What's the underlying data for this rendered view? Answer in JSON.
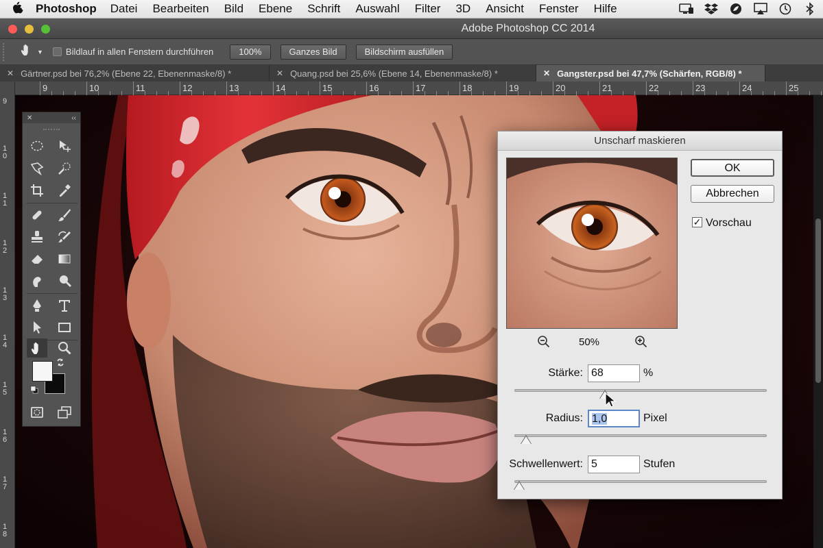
{
  "menubar": {
    "app_name": "Photoshop",
    "items": [
      "Datei",
      "Bearbeiten",
      "Bild",
      "Ebene",
      "Schrift",
      "Auswahl",
      "Filter",
      "3D",
      "Ansicht",
      "Fenster",
      "Hilfe"
    ]
  },
  "window": {
    "title": "Adobe Photoshop CC 2014"
  },
  "options_bar": {
    "scroll_all_label": "Bildlauf in allen Fenstern durchführen",
    "btn_100": "100%",
    "btn_fit": "Ganzes Bild",
    "btn_fill": "Bildschirm ausfüllen"
  },
  "tabs": [
    {
      "label": "Gärtner.psd bei 76,2% (Ebene 22, Ebenenmaske/8) *",
      "active": false
    },
    {
      "label": "Quang.psd bei 25,6% (Ebene 14, Ebenenmaske/8) *",
      "active": false
    },
    {
      "label": "Gangster.psd bei 47,7% (Schärfen, RGB/8) *",
      "active": true
    }
  ],
  "ruler": {
    "h_labels": [
      "9",
      "10",
      "11",
      "12",
      "13",
      "14",
      "15",
      "16",
      "17",
      "18",
      "19",
      "20",
      "21",
      "22",
      "23",
      "24",
      "25"
    ],
    "v_labels": [
      "9",
      "10",
      "11",
      "12",
      "13",
      "14",
      "15",
      "16",
      "17",
      "18"
    ]
  },
  "dialog": {
    "title": "Unscharf maskieren",
    "ok": "OK",
    "cancel": "Abbrechen",
    "preview_label": "Vorschau",
    "preview_checked": true,
    "zoom": "50%",
    "amount": {
      "label": "Stärke:",
      "value": "68",
      "unit": "%",
      "slider_fraction": 0.36
    },
    "radius": {
      "label": "Radius:",
      "value": "1,0",
      "unit": "Pixel",
      "slider_fraction": 0.045
    },
    "threshold": {
      "label": "Schwellenwert:",
      "value": "5",
      "unit": "Stufen",
      "slider_fraction": 0.02
    }
  },
  "colors": {
    "bandana_red": "#d8262b",
    "skin": "#d9a188",
    "background": "#140607"
  }
}
